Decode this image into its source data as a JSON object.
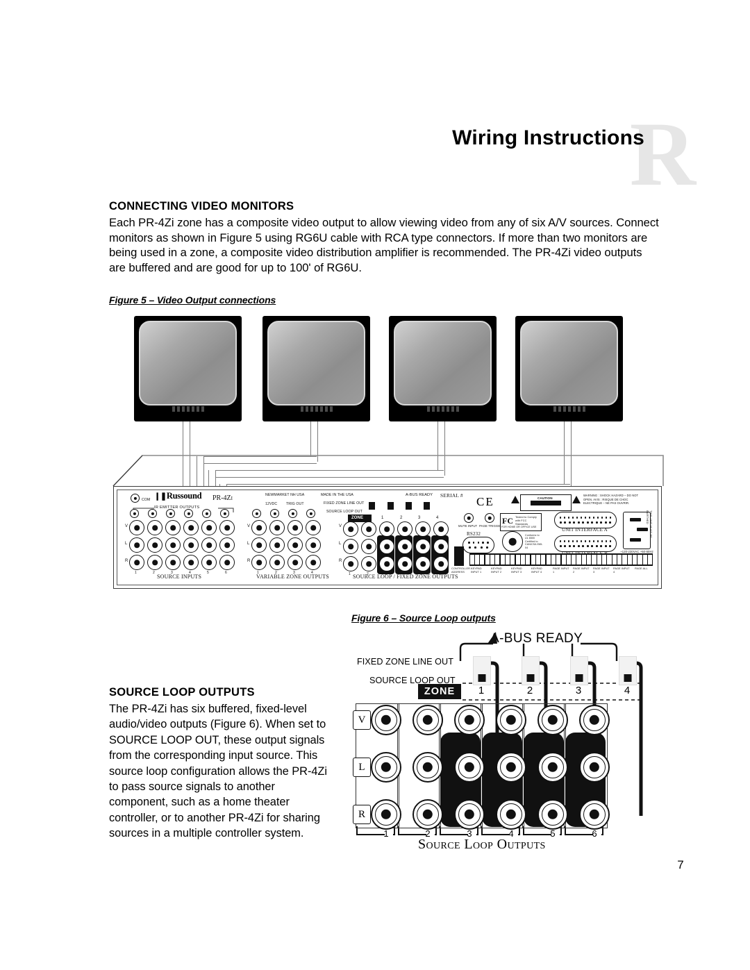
{
  "header": {
    "title": "Wiring Instructions",
    "watermark": "R"
  },
  "sections": {
    "video": {
      "heading": "CONNECTING VIDEO MONITORS",
      "body": "Each PR-4Zi zone has a composite video output to allow viewing video from any of six A/V sources. Connect monitors as shown in Figure 5 using RG6U cable with RCA type connectors. If more than two monitors are being used in a zone, a composite video distribution amplifier is recommended. The PR-4Zi video outputs are buffered and are good for up to 100' of RG6U."
    },
    "loop": {
      "heading": "SOURCE LOOP OUTPUTS",
      "body": "The PR-4Zi has six buffered, fixed-level audio/video outputs (Figure 6). When set to SOURCE LOOP OUT, these output signals from the corresponding input source. This source loop configuration allows the PR-4Zi to pass source signals to another component, such as a home theater controller, or to another PR-4Zi for sharing sources in a multiple controller system."
    }
  },
  "figure5": {
    "caption": "Figure 5 – Video Output connections",
    "monitor_count": 4,
    "panel": {
      "brand": "Russound",
      "model": "PR-4Zi",
      "com_label": "COM",
      "ir_label": "IR EMITTER OUTPUTS",
      "source_inputs_label": "SOURCE INPUTS",
      "variable_zone_label": "VARIABLE ZONE OUTPUTS",
      "source_loop_fixed_label": "SOURCE LOOP / FIXED ZONE OUTPUTS",
      "made_in_usa": "MADE IN THE USA",
      "newmarket": "NEWMARKET NH USA",
      "twelve_vdc": "12VDC",
      "trig_out": "TRIG OUT",
      "serial_label": "SERIAL #",
      "abus_ready": "A-BUS READY",
      "fixed_zone_line_out": "FIXED ZONE LINE OUT",
      "source_loop_out": "SOURCE LOOP OUT",
      "zone_label": "ZONE",
      "zone_numbers": [
        "1",
        "2",
        "3",
        "4"
      ],
      "jack_numbers_6": [
        "1",
        "2",
        "3",
        "4",
        "5",
        "6"
      ],
      "jack_numbers_4": [
        "1",
        "2",
        "3",
        "4"
      ],
      "row_labels": [
        "V",
        "L",
        "R"
      ],
      "mute_input": "MUTE INPUT",
      "page_trigger_output": "PAGE TRIGGER OUTPUT",
      "rs232": "RS232",
      "unit_interface_a": "UNIT INTERFACE A",
      "unit_interface_b": "UNIT INTERFACE B",
      "ce_mark": "CE",
      "caution_title": "CAUTION",
      "caution_body": "RISK OF ELECTRIC SHOCK DO NOT OPEN",
      "warning_text": "WARNING : SHOCK HAZARD – DO NOT OPEN. AVIS : RISQUE DE CHOC ELECTRIQUE – NE PAS OUVRIR.",
      "fcc_text": "Tested to Comply with FCC Standards",
      "fcc_use": "FOR HOME OR OFFICE USE",
      "fcc_mark": "FC",
      "ul_text": "Conforms to UL 6500 Certified to CAN/CSA E65-04",
      "mains": "~120-230VAC ~50-60Hz 1A",
      "earth_warning": "THIS UNIT MUST BE EARTHED",
      "controller_address": "CONTROLLER ADDRESS",
      "terminal_labels": [
        "KEYPAD INPUT 1",
        "KEYPAD INPUT 2",
        "KEYPAD INPUT 3",
        "KEYPAD INPUT 4",
        "PAGE INPUT 1",
        "PAGE INPUT 2",
        "PAGE INPUT 3",
        "PAGE INPUT 4",
        "PAGE ALL"
      ]
    }
  },
  "figure6": {
    "caption": "Figure 6 – Source Loop outputs",
    "abus_ready": "A-BUS READY",
    "fixed_zone_line_out": "FIXED ZONE LINE OUT",
    "source_loop_out": "SOURCE LOOP OUT",
    "zone_label": "ZONE",
    "zone_numbers": [
      "1",
      "2",
      "3",
      "4"
    ],
    "row_labels": [
      "V",
      "L",
      "R"
    ],
    "jack_numbers": [
      "1",
      "2",
      "3",
      "4",
      "5",
      "6"
    ],
    "title": "Source Loop Outputs",
    "highlighted_jacks": [
      3,
      4,
      5,
      6
    ]
  },
  "footer": {
    "page_number": "7"
  },
  "colors": {
    "watermark": "#e6e6e6",
    "ink": "#000000",
    "cable": "#7b7b7b",
    "screen_top": "#d0d0d0",
    "screen_bottom": "#9c9c9c"
  }
}
